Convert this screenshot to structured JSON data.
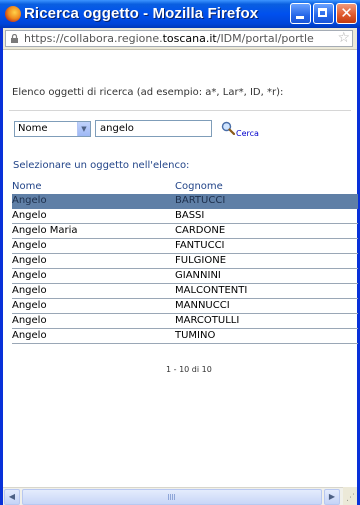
{
  "window": {
    "title": "Ricerca oggetto - Mozilla Firefox",
    "close_glyph": "✕"
  },
  "addressbar": {
    "url_prefix": "https://collabora.regione.",
    "url_domain": "toscana.it",
    "url_suffix": "/IDM/portal/portle",
    "bookmark_glyph": "☆"
  },
  "search": {
    "instructions": "Elenco oggetti di ricerca (ad esempio: a*, Lar*, ID, *r):",
    "field_selected": "Nome",
    "query": "angelo",
    "button_label": "Cerca",
    "select_prompt": "Selezionare un oggetto nell'elenco:"
  },
  "table": {
    "columns": [
      "Nome",
      "Cognome"
    ],
    "rows": [
      {
        "nome": "Angelo",
        "cognome": "BARTUCCI",
        "selected": true
      },
      {
        "nome": "Angelo",
        "cognome": "BASSI"
      },
      {
        "nome": "Angelo Maria",
        "cognome": "CARDONE"
      },
      {
        "nome": "Angelo",
        "cognome": "FANTUCCI"
      },
      {
        "nome": "Angelo",
        "cognome": "FULGIONE"
      },
      {
        "nome": "Angelo",
        "cognome": "GIANNINI"
      },
      {
        "nome": "Angelo",
        "cognome": "MALCONTENTI"
      },
      {
        "nome": "Angelo",
        "cognome": "MANNUCCI"
      },
      {
        "nome": "Angelo",
        "cognome": "MARCOTULLI"
      },
      {
        "nome": "Angelo",
        "cognome": "TUMINO"
      }
    ]
  },
  "pagination": "1 - 10 di 10",
  "colors": {
    "titlebar": "#0050ee",
    "selected_row": "#5f7fa6",
    "header_text": "#224488",
    "link": "#0000cc"
  },
  "icons": {
    "lock": "lock-icon",
    "search": "magnifier-icon",
    "bookmark": "star-icon"
  }
}
